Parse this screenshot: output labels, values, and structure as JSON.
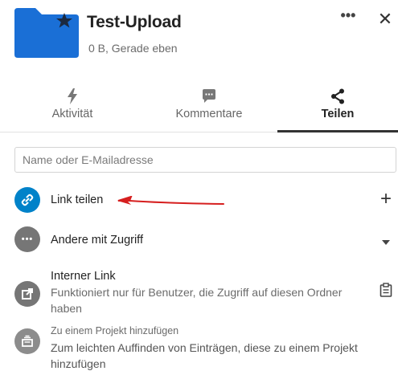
{
  "header": {
    "title": "Test-Upload",
    "subtitle": "0 B, Gerade eben",
    "more_icon": "more-icon",
    "close_icon": "close-icon",
    "folder_color": "#1a6fd6"
  },
  "tabs": [
    {
      "label": "Aktivität",
      "icon": "lightning-icon",
      "active": false
    },
    {
      "label": "Kommentare",
      "icon": "comment-icon",
      "active": false
    },
    {
      "label": "Teilen",
      "icon": "share-icon",
      "active": true
    }
  ],
  "search": {
    "placeholder": "Name oder E-Mailadresse",
    "value": ""
  },
  "share_list": {
    "link_share": {
      "label": "Link teilen",
      "icon": "link-icon",
      "action_icon": "plus-icon",
      "accent": "#0082c9"
    },
    "others_access": {
      "label": "Andere mit Zugriff",
      "icon": "more-icon",
      "action_icon": "caret-down-icon"
    },
    "internal_link": {
      "label": "Interner Link",
      "description": "Funktioniert nur für Benutzer, die Zugriff auf diesen Ordner haben",
      "icon": "external-link-icon",
      "action_icon": "clipboard-icon"
    },
    "project": {
      "label": "Zu einem Projekt hinzufügen",
      "description": "Zum leichten Auffinden von Einträgen, diese zu einem Projekt hinzufügen",
      "icon": "projects-icon"
    }
  },
  "annotation": {
    "arrow_color": "#d61f1f"
  }
}
